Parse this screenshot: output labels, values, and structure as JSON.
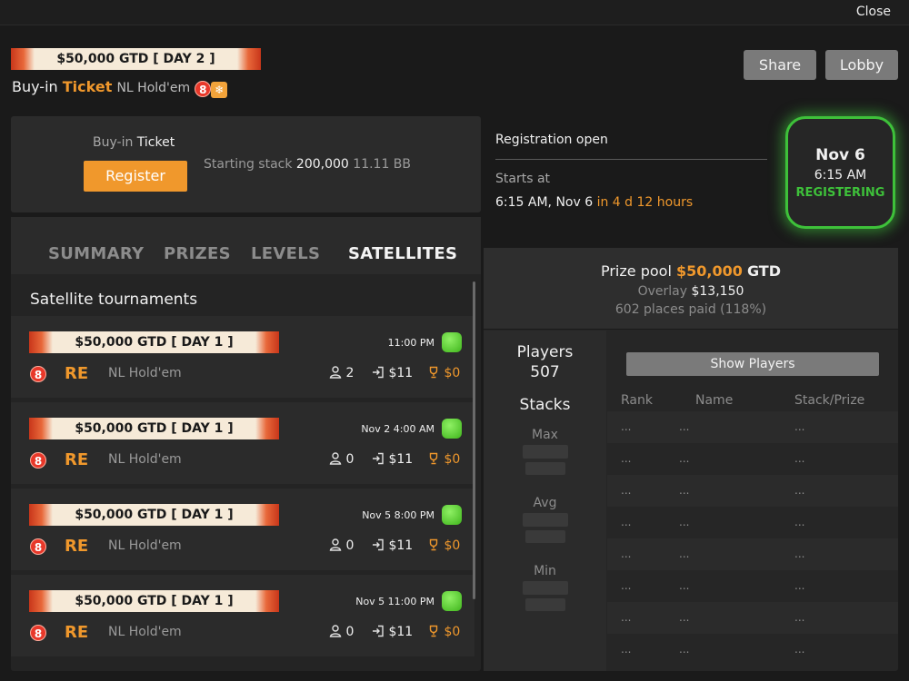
{
  "window": {
    "close_label": "Close"
  },
  "header": {
    "banner_text": "$50,000 GTD [ DAY 2 ]",
    "buyin_prefix": "Buy-in",
    "buyin_ticket": "Ticket",
    "game_type": "NL Hold'em",
    "badge_number": "8",
    "snow_icon": "❄",
    "share_label": "Share",
    "lobby_label": "Lobby"
  },
  "registration": {
    "buyin_prefix": "Buy-in",
    "buyin_value": "Ticket",
    "register_label": "Register",
    "starting_stack_label": "Starting stack",
    "starting_stack_value": "200,000",
    "starting_stack_bb": "11.11 BB",
    "status": "Registration open",
    "starts_at_label": "Starts at",
    "starts_time": "6:15 AM, Nov 6",
    "starts_countdown": "in 4 d 12 hours"
  },
  "date_badge": {
    "day": "Nov 6",
    "time": "6:15 AM",
    "state": "REGISTERING"
  },
  "tabs": [
    {
      "label": "SUMMARY"
    },
    {
      "label": "PRIZES"
    },
    {
      "label": "LEVELS"
    },
    {
      "label": "SATELLITES"
    }
  ],
  "satellites": {
    "title": "Satellite tournaments",
    "items": [
      {
        "banner": "$50,000 GTD [ DAY 1 ]",
        "time": "11:00 PM",
        "badge": "8",
        "re": "RE",
        "game": "NL Hold'em",
        "players": "2",
        "buyin": "$11",
        "prize": "$0"
      },
      {
        "banner": "$50,000 GTD [ DAY 1 ]",
        "time": "Nov 2 4:00 AM",
        "badge": "8",
        "re": "RE",
        "game": "NL Hold'em",
        "players": "0",
        "buyin": "$11",
        "prize": "$0"
      },
      {
        "banner": "$50,000 GTD [ DAY 1 ]",
        "time": "Nov 5 8:00 PM",
        "badge": "8",
        "re": "RE",
        "game": "NL Hold'em",
        "players": "0",
        "buyin": "$11",
        "prize": "$0"
      },
      {
        "banner": "$50,000 GTD [ DAY 1 ]",
        "time": "Nov 5 11:00 PM",
        "badge": "8",
        "re": "RE",
        "game": "NL Hold'em",
        "players": "0",
        "buyin": "$11",
        "prize": "$0"
      }
    ]
  },
  "prize_pool": {
    "label": "Prize pool",
    "amount": "$50,000",
    "suffix": "GTD",
    "overlay_label": "Overlay",
    "overlay_value": "$13,150",
    "places_paid": "602 places paid (118%)"
  },
  "players": {
    "label": "Players",
    "count": "507",
    "stacks_label": "Stacks",
    "max_label": "Max",
    "avg_label": "Avg",
    "min_label": "Min",
    "show_players_label": "Show Players",
    "columns": [
      "Rank",
      "Name",
      "Stack/Prize"
    ],
    "rows": [
      [
        "...",
        "...",
        "..."
      ],
      [
        "...",
        "...",
        "..."
      ],
      [
        "...",
        "...",
        "..."
      ],
      [
        "...",
        "...",
        "..."
      ],
      [
        "...",
        "...",
        "..."
      ],
      [
        "...",
        "...",
        "..."
      ],
      [
        "...",
        "...",
        "..."
      ],
      [
        "...",
        "...",
        "..."
      ]
    ]
  },
  "colors": {
    "accent": "#f0982c",
    "status_green": "#3ec13a",
    "badge_red": "#e8382a"
  }
}
